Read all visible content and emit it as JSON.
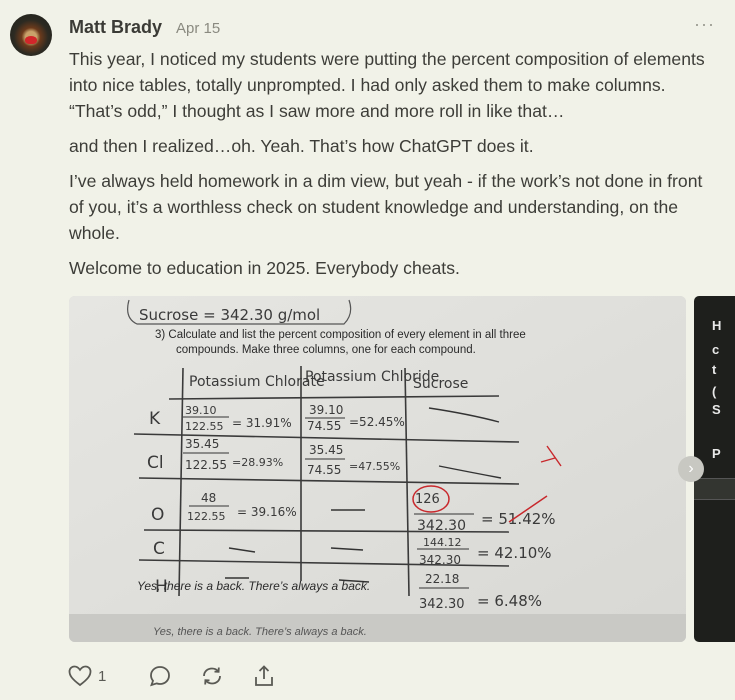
{
  "post": {
    "author": "Matt Brady",
    "date": "Apr 15",
    "more": "···",
    "paragraphs": [
      "This year, I noticed my students were putting the percent composition of elements into nice tables, totally unprompted. I had only asked them to make columns. “That’s odd,” I thought as I saw more and more roll in like that…",
      "and then I realized…oh. Yeah. That’s how ChatGPT does it.",
      "I’ve always held homework in a dim view, but yeah - if the work’s not done in front of you, it’s a worthless check on student knowledge and understanding, on the whole.",
      "Welcome to education in 2025. Everybody cheats."
    ]
  },
  "image": {
    "header": "Sucrose = 342.30 g/mol",
    "question_line1": "3)  Calculate and list the percent composition of every element in all three",
    "question_line2": "compounds. Make three columns, one for each compound.",
    "columns": [
      "Potassium Chlorate",
      "Potassium Chloride",
      "Sucrose"
    ],
    "row_labels": [
      "K",
      "Cl",
      "O",
      "C",
      "H"
    ],
    "cells": {
      "k_chlorate_num": "39.10",
      "k_chlorate_den": "122.55",
      "k_chlorate_res": "= 31.91%",
      "k_chloride_num": "39.10",
      "k_chloride_den": "74.55",
      "k_chloride_res": "=52.45%",
      "cl_chlorate_num": "35.45",
      "cl_chlorate_den": "122.55",
      "cl_chlorate_res": "=28.93%",
      "cl_chloride_num": "35.45",
      "cl_chloride_den": "74.55",
      "cl_chloride_res": "=47.55%",
      "o_chlorate_num": "48",
      "o_chlorate_den": "122.55",
      "o_chlorate_res": "= 39.16%",
      "o_sucrose_num": "126",
      "o_sucrose_den": "342.30",
      "o_sucrose_res": "= 51.42%",
      "c_sucrose_num": "144.12",
      "c_sucrose_den": "342.30",
      "c_sucrose_res": "= 42.10%",
      "h_sucrose_num": "22.18",
      "h_sucrose_den": "342.30",
      "h_sucrose_res": "= 6.48%"
    },
    "caption": "Yes, there is a back. There’s always a back.",
    "caption_shadow": "Yes, there is a back. There’s always a back."
  },
  "next_image": {
    "glyphs": [
      "H",
      "c",
      "t",
      "(",
      "S",
      "P"
    ]
  },
  "actions": {
    "like_count": "1"
  },
  "colors": {
    "background": "#f1f2e8",
    "text": "#3d3d38",
    "muted": "#8a8a80",
    "red_ink": "#c8282c"
  }
}
